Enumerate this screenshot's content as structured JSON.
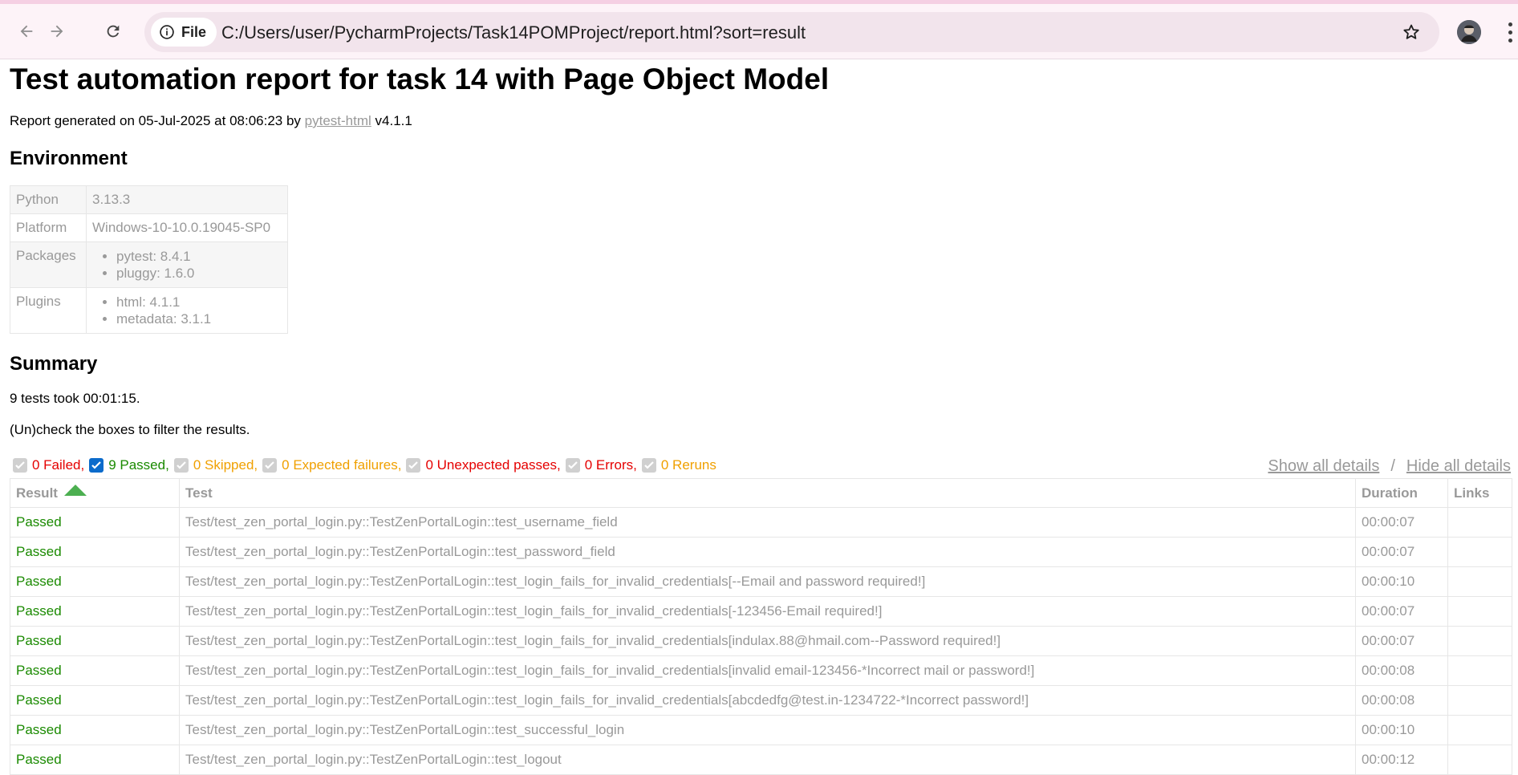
{
  "browser": {
    "back_icon": "arrow-left-icon",
    "forward_icon": "arrow-right-icon",
    "reload_icon": "reload-icon",
    "info_icon": "info-icon",
    "file_label": "File",
    "url": "C:/Users/user/PycharmProjects/Task14POMProject/report.html?sort=result",
    "bookmark_icon": "star-icon",
    "menu_icon": "kebab-menu-icon"
  },
  "report": {
    "title": "Test automation report for task 14 with Page Object Model",
    "generated_prefix": "Report generated on 05-Jul-2025 at 08:06:23 by ",
    "generated_link": "pytest-html",
    "generated_suffix": " v4.1.1"
  },
  "environment": {
    "heading": "Environment",
    "rows": [
      {
        "key": "Python",
        "value": "3.13.3"
      },
      {
        "key": "Platform",
        "value": "Windows-10-10.0.19045-SP0"
      },
      {
        "key": "Packages",
        "items": [
          "pytest: 8.4.1",
          "pluggy: 1.6.0"
        ]
      },
      {
        "key": "Plugins",
        "items": [
          "html: 4.1.1",
          "metadata: 3.1.1"
        ]
      }
    ]
  },
  "summary": {
    "heading": "Summary",
    "duration_text": "9 tests took 00:01:15.",
    "filter_hint": "(Un)check the boxes to filter the results.",
    "filters": [
      {
        "label": "0 Failed,",
        "checked": false,
        "color": "#e50000"
      },
      {
        "label": "9 Passed,",
        "checked": true,
        "color": "#1a8a00"
      },
      {
        "label": "0 Skipped,",
        "checked": false,
        "color": "#f0a000"
      },
      {
        "label": "0 Expected failures,",
        "checked": false,
        "color": "#f0a000"
      },
      {
        "label": "0 Unexpected passes,",
        "checked": false,
        "color": "#e50000"
      },
      {
        "label": "0 Errors,",
        "checked": false,
        "color": "#e50000"
      },
      {
        "label": "0 Reruns",
        "checked": false,
        "color": "#f0a000"
      }
    ],
    "show_all": "Show all details",
    "separator": "/",
    "hide_all": "Hide all details"
  },
  "results": {
    "columns": [
      "Result",
      "Test",
      "Duration",
      "Links"
    ],
    "rows": [
      {
        "result": "Passed",
        "test": "Test/test_zen_portal_login.py::TestZenPortalLogin::test_username_field",
        "duration": "00:00:07",
        "links": ""
      },
      {
        "result": "Passed",
        "test": "Test/test_zen_portal_login.py::TestZenPortalLogin::test_password_field",
        "duration": "00:00:07",
        "links": ""
      },
      {
        "result": "Passed",
        "test": "Test/test_zen_portal_login.py::TestZenPortalLogin::test_login_fails_for_invalid_credentials[--Email and password required!]",
        "duration": "00:00:10",
        "links": ""
      },
      {
        "result": "Passed",
        "test": "Test/test_zen_portal_login.py::TestZenPortalLogin::test_login_fails_for_invalid_credentials[-123456-Email required!]",
        "duration": "00:00:07",
        "links": ""
      },
      {
        "result": "Passed",
        "test": "Test/test_zen_portal_login.py::TestZenPortalLogin::test_login_fails_for_invalid_credentials[indulax.88@hmail.com--Password required!]",
        "duration": "00:00:07",
        "links": ""
      },
      {
        "result": "Passed",
        "test": "Test/test_zen_portal_login.py::TestZenPortalLogin::test_login_fails_for_invalid_credentials[invalid email-123456-*Incorrect mail or password!]",
        "duration": "00:00:08",
        "links": ""
      },
      {
        "result": "Passed",
        "test": "Test/test_zen_portal_login.py::TestZenPortalLogin::test_login_fails_for_invalid_credentials[abcdedfg@test.in-1234722-*Incorrect password!]",
        "duration": "00:00:08",
        "links": ""
      },
      {
        "result": "Passed",
        "test": "Test/test_zen_portal_login.py::TestZenPortalLogin::test_successful_login",
        "duration": "00:00:10",
        "links": ""
      },
      {
        "result": "Passed",
        "test": "Test/test_zen_portal_login.py::TestZenPortalLogin::test_logout",
        "duration": "00:00:12",
        "links": ""
      }
    ]
  }
}
